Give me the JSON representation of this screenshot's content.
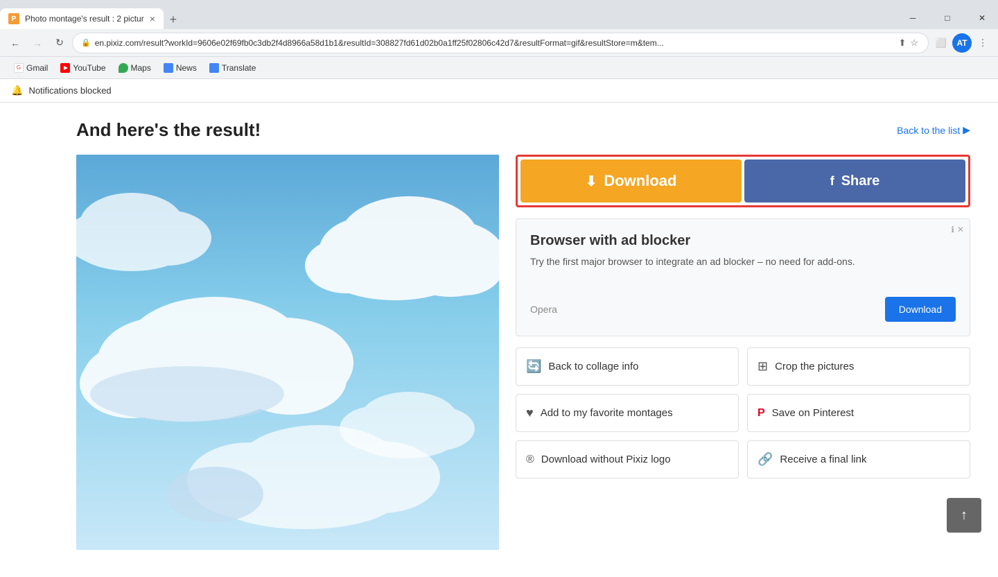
{
  "tab": {
    "favicon_label": "P",
    "title": "Photo montage's result : 2 pictur",
    "close_label": "×"
  },
  "new_tab_label": "+",
  "window_controls": {
    "minimize": "─",
    "maximize": "□",
    "close": "✕"
  },
  "nav": {
    "back_label": "←",
    "forward_label": "→",
    "refresh_label": "↻",
    "home_label": "⌂",
    "lock_label": "🔒",
    "address": "en.pixiz.com/result?workId=9606e02f69fb0c3db2f4d8966a58d1b1&resultId=308827fd61d02b0a1ff25f02806c42d7&resultFormat=gif&resultStore=m&tem...",
    "share_addr_label": "⬆",
    "star_label": "☆",
    "extensions_label": "⬜",
    "profile_label": "AT",
    "menu_label": "⋮"
  },
  "bookmarks": [
    {
      "name": "Gmail",
      "label": "Gmail",
      "icon_type": "gmail"
    },
    {
      "name": "YouTube",
      "label": "YouTube",
      "icon_type": "youtube"
    },
    {
      "name": "Maps",
      "label": "Maps",
      "icon_type": "maps"
    },
    {
      "name": "News",
      "label": "News",
      "icon_type": "news"
    },
    {
      "name": "Translate",
      "label": "Translate",
      "icon_type": "translate"
    }
  ],
  "notification": {
    "icon": "🔔",
    "text": "Notifications blocked"
  },
  "page": {
    "result_title": "And here's the result!",
    "back_to_list": "Back to the list",
    "back_arrow": "▶"
  },
  "download_btn": {
    "icon": "⬇",
    "label": "Download"
  },
  "share_btn": {
    "icon": "f",
    "label": "Share"
  },
  "ad": {
    "info_icon": "ℹ",
    "close_icon": "✕",
    "title": "Browser with ad blocker",
    "text": "Try the first major browser to integrate an ad blocker – no need for add-ons.",
    "brand": "Opera",
    "download_label": "Download"
  },
  "action_buttons": [
    {
      "icon": "🔄",
      "label": "Back to collage info"
    },
    {
      "icon": "✂",
      "label": "Crop the pictures"
    },
    {
      "icon": "♥",
      "label": "Add to my favorite montages"
    },
    {
      "icon": "🅟",
      "label": "Save on Pinterest"
    },
    {
      "icon": "®",
      "label": "Download without Pixiz logo"
    },
    {
      "icon": "🔗",
      "label": "Receive a final link"
    }
  ],
  "scroll_top_icon": "↑",
  "colors": {
    "download_orange": "#f5a623",
    "share_blue": "#4a67a8",
    "highlight_red": "#e53935",
    "accent_blue": "#1a73e8"
  }
}
